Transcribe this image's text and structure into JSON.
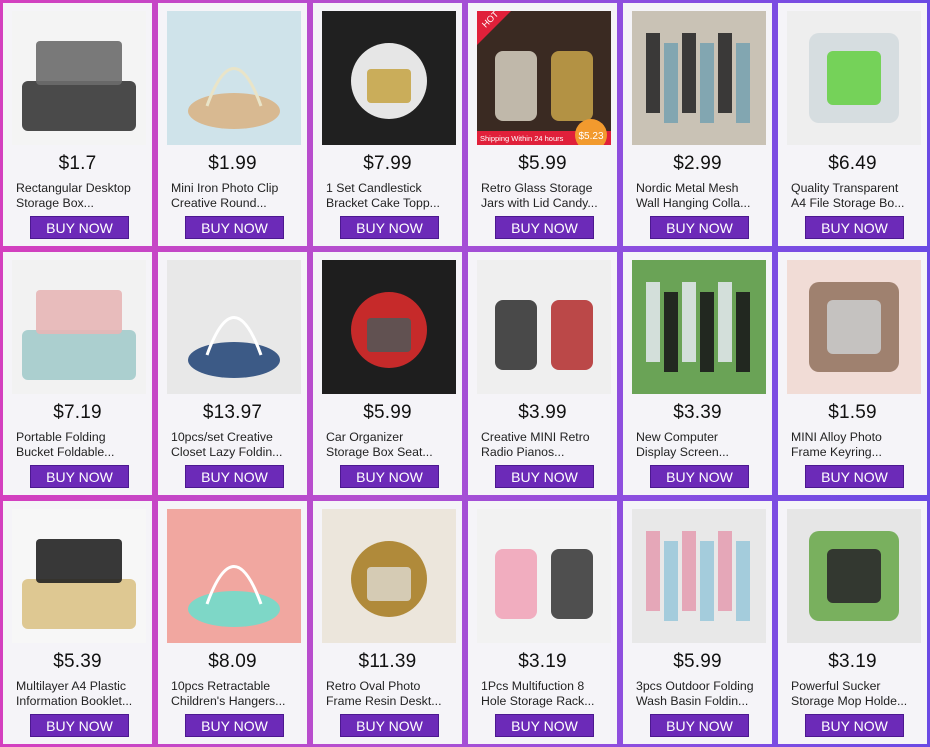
{
  "products": [
    {
      "price": "$1.7",
      "title1": "Rectangular Desktop",
      "title2": "Storage Box...",
      "button": "BUY NOW",
      "image": "desktop-storage-box",
      "colors": [
        "#f4f4f4",
        "#2b2b2b",
        "#6b6b6b"
      ]
    },
    {
      "price": "$1.99",
      "title1": "Mini Iron Photo Clip",
      "title2": "Creative Round...",
      "button": "BUY NOW",
      "image": "photo-clips",
      "colors": [
        "#cfe3ea",
        "#d8b991",
        "#e9e4c8"
      ]
    },
    {
      "price": "$7.99",
      "title1": "1 Set Candlestick",
      "title2": "Bracket Cake Topp...",
      "button": "BUY NOW",
      "image": "candlestick-cake-topper",
      "colors": [
        "#202020",
        "#e6e6e6",
        "#c7a64a"
      ]
    },
    {
      "price": "$5.99",
      "title1": "Retro Glass Storage",
      "title2": "Jars with Lid Candy...",
      "button": "BUY NOW",
      "image": "glass-jars",
      "colors": [
        "#3a2a22",
        "#d8d1c2",
        "#c9a44a"
      ],
      "badge": "HOT",
      "banner": "Shipping Within 24 hours",
      "banner_price": "$5.23"
    },
    {
      "price": "$2.99",
      "title1": "Nordic Metal Mesh",
      "title2": "Wall Hanging Colla...",
      "button": "BUY NOW",
      "image": "mesh-wall-grid",
      "colors": [
        "#c9c2b5",
        "#2a2a2a",
        "#7aa3b0"
      ]
    },
    {
      "price": "$6.49",
      "title1": "Quality Transparent",
      "title2": "A4 File Storage Bo...",
      "button": "BUY NOW",
      "image": "file-storage-box",
      "colors": [
        "#eeeeee",
        "#cfd8dc",
        "#6ad04a"
      ]
    },
    {
      "price": "$7.19",
      "title1": "Portable Folding",
      "title2": "Bucket Foldable...",
      "button": "BUY NOW",
      "image": "folding-bucket",
      "colors": [
        "#f2f2f2",
        "#9fc9c9",
        "#e7b6b6"
      ]
    },
    {
      "price": "$13.97",
      "title1": "10pcs/set Creative",
      "title2": "Closet Lazy Foldin...",
      "button": "BUY NOW",
      "image": "closet-organizer",
      "colors": [
        "#e8e8e8",
        "#3c5a86",
        "#ffffff"
      ]
    },
    {
      "price": "$5.99",
      "title1": "Car Organizer",
      "title2": "Storage Box Seat...",
      "button": "BUY NOW",
      "image": "car-organizer",
      "colors": [
        "#1e1e1e",
        "#c62a2a",
        "#555555"
      ]
    },
    {
      "price": "$3.99",
      "title1": "Creative MINI Retro",
      "title2": "Radio Pianos...",
      "button": "BUY NOW",
      "image": "mini-retro-models",
      "colors": [
        "#efefef",
        "#2b2b2b",
        "#b22a2a"
      ]
    },
    {
      "price": "$3.39",
      "title1": "New Computer",
      "title2": "Display Screen...",
      "button": "BUY NOW",
      "image": "screen-phone-holder",
      "colors": [
        "#6aa356",
        "#dfe6e9",
        "#1b1b1b"
      ]
    },
    {
      "price": "$1.59",
      "title1": "MINI Alloy Photo",
      "title2": "Frame Keyring...",
      "button": "BUY NOW",
      "image": "mini-photo-frames",
      "colors": [
        "#f1dcd6",
        "#8b6a55",
        "#c9c9c9"
      ]
    },
    {
      "price": "$5.39",
      "title1": "Multilayer A4 Plastic",
      "title2": "Information Booklet...",
      "button": "BUY NOW",
      "image": "a4-booklets",
      "colors": [
        "#f7f7f7",
        "#d9c080",
        "#222222"
      ]
    },
    {
      "price": "$8.09",
      "title1": "10pcs Retractable",
      "title2": "Children's Hangers...",
      "button": "BUY NOW",
      "image": "kids-hangers",
      "colors": [
        "#f1a7a0",
        "#7ed7c7",
        "#ffffff"
      ]
    },
    {
      "price": "$11.39",
      "title1": "Retro Oval Photo",
      "title2": "Frame Resin Deskt...",
      "button": "BUY NOW",
      "image": "oval-photo-frames",
      "colors": [
        "#ece6dc",
        "#b08a3a",
        "#d9d2c2"
      ]
    },
    {
      "price": "$3.19",
      "title1": "1Pcs Multifuction 8",
      "title2": "Hole Storage Rack...",
      "button": "BUY NOW",
      "image": "belt-storage-rack",
      "colors": [
        "#f2f2f2",
        "#f1a1b6",
        "#333333"
      ]
    },
    {
      "price": "$5.99",
      "title1": "3pcs Outdoor Folding",
      "title2": "Wash Basin Foldin...",
      "button": "BUY NOW",
      "image": "folding-wash-basin",
      "colors": [
        "#e8e8e8",
        "#e4a0b3",
        "#9cc9da"
      ]
    },
    {
      "price": "$3.19",
      "title1": "Powerful Sucker",
      "title2": "Storage Mop Holde...",
      "button": "BUY NOW",
      "image": "mop-holder",
      "colors": [
        "#e6e6e6",
        "#5ea33c",
        "#2b2b2b"
      ]
    }
  ]
}
